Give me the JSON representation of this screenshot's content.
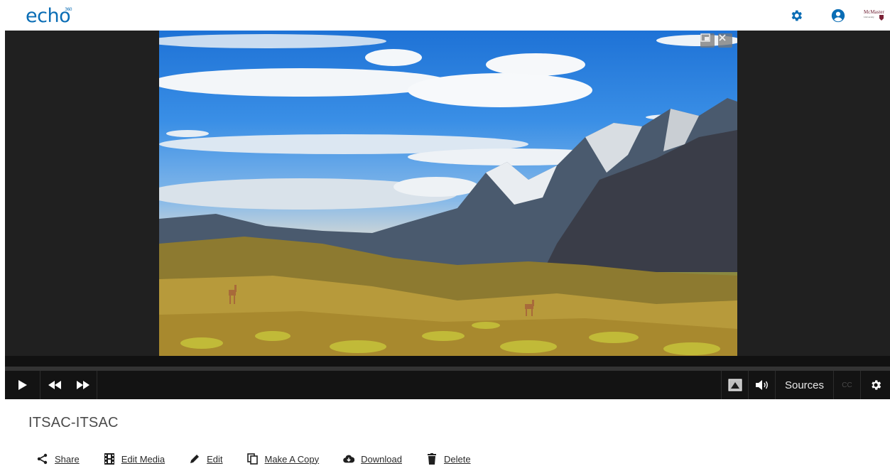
{
  "header": {
    "logo_text": "echo",
    "logo_superscript": "360",
    "org_logo_text": "McMaster University",
    "icons": [
      "gear-icon",
      "user-circle-icon"
    ],
    "accent_color": "#0a6db5"
  },
  "player": {
    "controls": {
      "sources_label": "Sources",
      "cc_label": "CC"
    },
    "icons": [
      "play-icon",
      "rewind-icon",
      "fast-forward-icon",
      "picture-in-picture-icon",
      "volume-icon",
      "gear-icon",
      "popout-icon",
      "close-icon"
    ]
  },
  "media": {
    "title": "ITSAC-ITSAC"
  },
  "actions": [
    {
      "label": "Share",
      "icon": "share-icon"
    },
    {
      "label": "Edit Media",
      "icon": "film-icon"
    },
    {
      "label": "Edit",
      "icon": "pencil-icon"
    },
    {
      "label": "Make A Copy",
      "icon": "copy-icon"
    },
    {
      "label": "Download",
      "icon": "cloud-download-icon"
    },
    {
      "label": "Delete",
      "icon": "trash-icon"
    }
  ]
}
